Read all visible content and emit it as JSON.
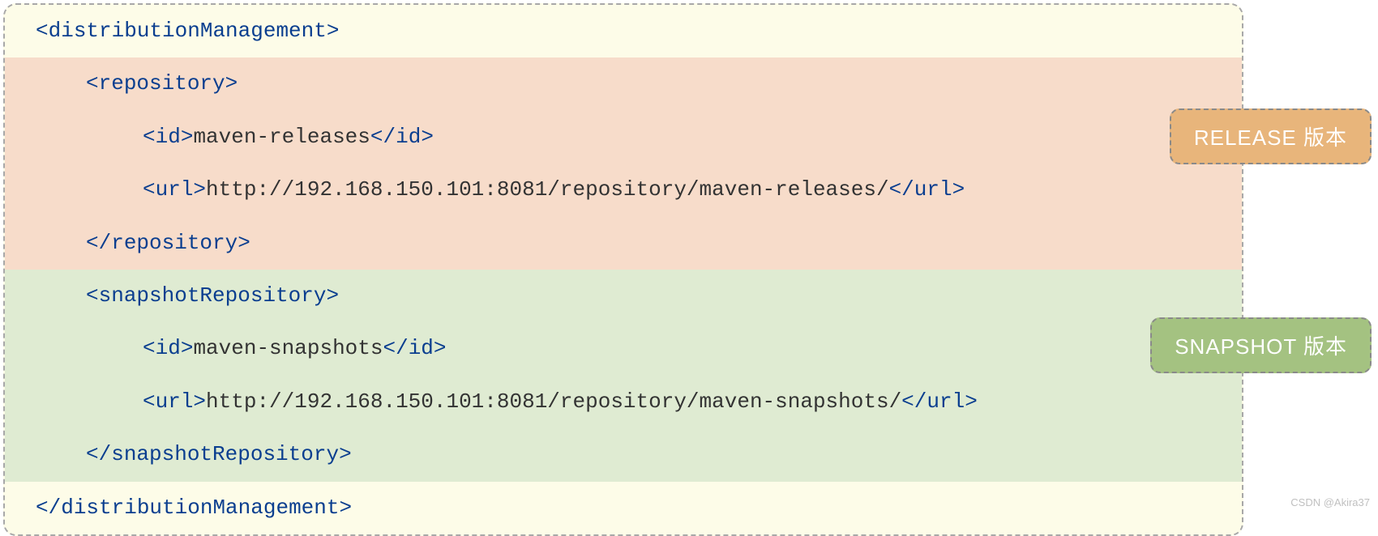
{
  "code": {
    "root_open": "distributionManagement",
    "root_close": "distributionManagement",
    "release": {
      "repo_open": "repository",
      "repo_close": "repository",
      "id_tag": "id",
      "id_value": "maven-releases",
      "url_tag": "url",
      "url_value": "http://192.168.150.101:8081/repository/maven-releases/"
    },
    "snapshot": {
      "repo_open": "snapshotRepository",
      "repo_close": "snapshotRepository",
      "id_tag": "id",
      "id_value": "maven-snapshots",
      "url_tag": "url",
      "url_value": "http://192.168.150.101:8081/repository/maven-snapshots/"
    }
  },
  "badges": {
    "release_label": "RELEASE 版本",
    "snapshot_label": "SNAPSHOT 版本"
  },
  "watermark": "CSDN @Akira37",
  "colors": {
    "tag_color": "#0a3e8f",
    "text_color": "#333333",
    "bg_yellow": "#fdfce8",
    "bg_orange": "#f7dcca",
    "bg_green": "#dfebd2",
    "badge_release_bg": "#e8b57b",
    "badge_snapshot_bg": "#a4c281"
  }
}
